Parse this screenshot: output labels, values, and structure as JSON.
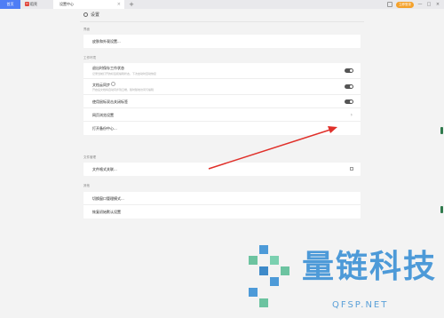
{
  "tabs": {
    "home": "首页",
    "doc": "稻壳",
    "settings": "设置中心",
    "add": "+"
  },
  "topbar": {
    "login": "立即登录",
    "minimize": "—",
    "restore": "□",
    "close": "×"
  },
  "page": {
    "title": "设置"
  },
  "sections": {
    "general": {
      "label": "界面",
      "rows": [
        "皮肤和外观设置..."
      ]
    },
    "workspace": {
      "label": "工作环境",
      "restore_title": "退出时保存工作状态",
      "restore_desc": "记录当前打开的标签和编辑状态，下次启动时自动恢复",
      "sync_title": "文档云同步",
      "sync_desc": "开启后文档将自动同步到云端，随时随地访问与编辑",
      "mouse_title": "使用鼠标双击关闭标签",
      "proxy_title": "网页浏览设置",
      "backup_title": "打开备份中心..."
    },
    "file_mgmt": {
      "label": "文件管理",
      "rows": [
        "文件格式关联..."
      ]
    },
    "other": {
      "label": "其他",
      "rows": [
        "切换窗口管理模式...",
        "恢复初始默认设置"
      ]
    }
  },
  "watermark": {
    "brand": "量链科技",
    "domain": "QFSP.NET"
  },
  "colors": {
    "accent": "#4e7df5",
    "login": "#f4a12b",
    "arrow": "#e0302a",
    "watermark": "#4d9ad8"
  }
}
